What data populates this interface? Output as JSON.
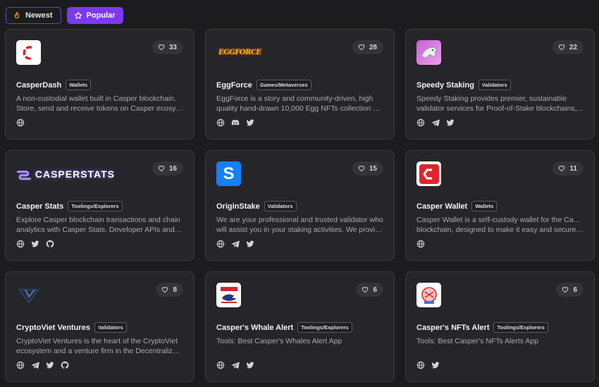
{
  "filters": [
    {
      "label": "Newest",
      "icon": "flame-icon",
      "active": false
    },
    {
      "label": "Popular",
      "icon": "star-icon",
      "active": true
    }
  ],
  "colors": {
    "accent": "#7c3aed",
    "card_bg": "#26262a",
    "page_bg": "#1c1c1f"
  },
  "cards": [
    {
      "name": "CasperDash",
      "tag": "Wallets",
      "likes": "33",
      "desc1": "A non-custodial wallet built in Casper blockchain.",
      "desc2": "Store, send and receive tokens on Casper ecosystem...",
      "socials": [
        "globe-icon"
      ]
    },
    {
      "name": "EggForce",
      "tag": "Games/Metaverses",
      "likes": "28",
      "logo_text": "EGGFORCE",
      "desc1": "EggForce is a story and community-driven, high",
      "desc2": "quality hand-drawn 10,000 Egg NFTs collection on...",
      "socials": [
        "globe-icon",
        "discord-icon",
        "twitter-icon"
      ]
    },
    {
      "name": "Speedy Staking",
      "tag": "Validators",
      "likes": "22",
      "desc1": "Speedy Staking provides premier, sustainable",
      "desc2": "validator services for Proof-of-Stake blockchains,...",
      "socials": [
        "globe-icon",
        "telegram-icon",
        "twitter-icon"
      ]
    },
    {
      "name": "Casper Stats",
      "tag": "Toolings/Explorers",
      "likes": "16",
      "logo_text": "CASPERSTATS",
      "desc1": "Explore Casper blockchain transactions and chain",
      "desc2": "analytics with Casper Stats. Developer APIs and usef...",
      "socials": [
        "globe-icon",
        "twitter-icon",
        "github-icon"
      ]
    },
    {
      "name": "OriginStake",
      "tag": "Validators",
      "likes": "15",
      "desc1": "We are your professional and trusted validator who",
      "desc2": "will assist you in your staking activities. We provide...",
      "socials": [
        "globe-icon",
        "telegram-icon",
        "twitter-icon"
      ]
    },
    {
      "name": "Casper Wallet",
      "tag": "Wallets",
      "likes": "11",
      "desc1": "Casper Wallet is a self-custody wallet for the Casper",
      "desc2": "blockchain, designed to make it easy and secure for...",
      "socials": [
        "globe-icon"
      ]
    },
    {
      "name": "CryptoViet Ventures",
      "tag": "Validators",
      "likes": "8",
      "desc1": "CryptoViet Ventures is the heart of the CryptoViet",
      "desc2": "ecosystem and a venture firm in the Decentralized...",
      "socials": [
        "globe-icon",
        "telegram-icon",
        "twitter-icon",
        "github-icon"
      ]
    },
    {
      "name": "Casper's Whale Alert",
      "tag": "Toolings/Explorers",
      "likes": "6",
      "desc1": "Tools: Best Casper's Whales Alert App",
      "desc2": "",
      "socials": [
        "globe-icon",
        "telegram-icon",
        "twitter-icon"
      ]
    },
    {
      "name": "Casper's NFTs Alert",
      "tag": "Toolings/Explorers",
      "likes": "6",
      "desc1": "Tools: Best Casper's NFTs Alerts App",
      "desc2": "",
      "socials": [
        "globe-icon",
        "twitter-icon"
      ]
    }
  ]
}
